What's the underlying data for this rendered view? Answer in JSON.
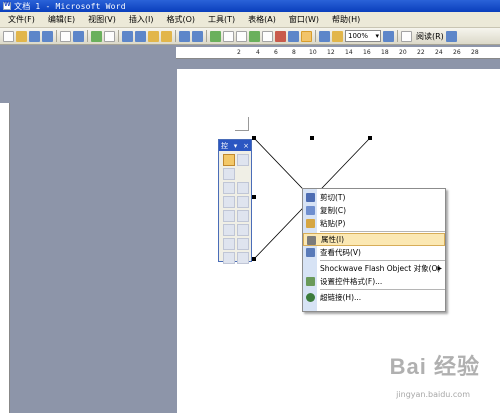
{
  "window": {
    "title": "文档 1 - Microsoft Word"
  },
  "menu": [
    "文件(F)",
    "编辑(E)",
    "视图(V)",
    "插入(I)",
    "格式(O)",
    "工具(T)",
    "表格(A)",
    "窗口(W)",
    "帮助(H)"
  ],
  "toolbar": {
    "zoom": "100%",
    "read_label": "阅读(R)"
  },
  "ruler": {
    "top_numbers": [
      "2",
      "4",
      "6",
      "8",
      "10",
      "12",
      "14",
      "16",
      "18",
      "20",
      "22",
      "24",
      "26",
      "28"
    ]
  },
  "toolbox": {
    "title": "控",
    "menu_glyph": "▾",
    "close_glyph": "×"
  },
  "context_menu": [
    {
      "label": "剪切(T)",
      "icon": "scissors-icon",
      "color": "#4d6db3"
    },
    {
      "label": "复制(C)",
      "icon": "copy-icon",
      "color": "#6f8fcf"
    },
    {
      "label": "粘贴(P)",
      "icon": "paste-icon",
      "color": "#d6a642"
    },
    {
      "sep": true
    },
    {
      "label": "属性(I)",
      "icon": "properties-icon",
      "color": "#7b7b7b",
      "highlight": true
    },
    {
      "label": "查看代码(V)",
      "icon": "view-code-icon",
      "color": "#5a7bb9"
    },
    {
      "sep": true
    },
    {
      "label": "Shockwave Flash Object 对象(O)",
      "icon": "",
      "submenu": true
    },
    {
      "label": "设置控件格式(F)...",
      "icon": "format-control-icon",
      "color": "#6a9a5a"
    },
    {
      "sep": true
    },
    {
      "label": "超链接(H)...",
      "icon": "hyperlink-icon",
      "color": "#3c7c3c"
    }
  ],
  "watermark": {
    "brand": "Bai 经验",
    "url": "jingyan.baidu.com"
  }
}
